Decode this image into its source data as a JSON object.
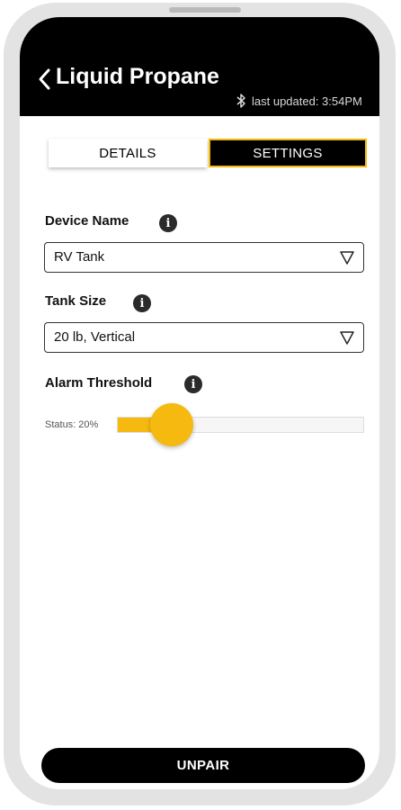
{
  "header": {
    "title": "Liquid Propane",
    "last_updated": "last updated: 3:54PM",
    "back_icon": "chevron-left-icon",
    "bluetooth_icon": "bluetooth-icon"
  },
  "tabs": [
    {
      "label": "DETAILS",
      "active": false
    },
    {
      "label": "SETTINGS",
      "active": true
    }
  ],
  "settings": {
    "device_name": {
      "label": "Device Name",
      "value": "RV Tank"
    },
    "tank_size": {
      "label": "Tank Size",
      "value": "20 lb, Vertical"
    },
    "alarm_threshold": {
      "label": "Alarm Threshold",
      "status": "Status: 20%",
      "percent": 20
    },
    "info_icon": "info-icon",
    "dropdown_icon": "triangle-down-icon"
  },
  "footer": {
    "unpair_label": "UNPAIR"
  },
  "colors": {
    "accent": "#f5b90f",
    "header_bg": "#000000",
    "frame": "#e3e3e3"
  }
}
